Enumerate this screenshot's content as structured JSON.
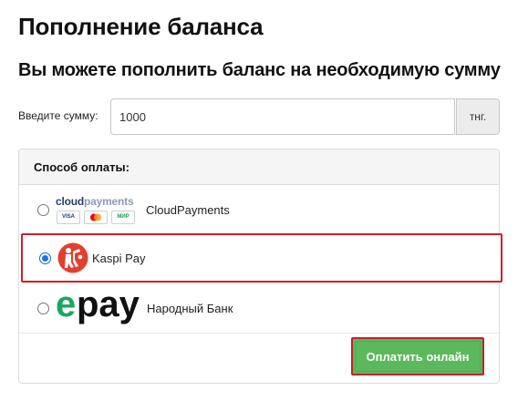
{
  "page": {
    "title": "Пополнение баланса",
    "subtitle": "Вы можете пополнить баланс на необходимую сумму"
  },
  "amount": {
    "label": "Введите сумму:",
    "value": "1000",
    "currency": "тнг."
  },
  "payment": {
    "header": "Способ оплаты:",
    "options": [
      {
        "label": "CloudPayments",
        "selected": false,
        "logo": {
          "word_part1": "cloud",
          "word_part2": "payments",
          "cards": [
            "VISA",
            "MC",
            "МИР"
          ]
        }
      },
      {
        "label": "Kaspi Pay",
        "selected": true,
        "logo": {
          "icon": "kaspi-logo-icon",
          "color": "#e2402f"
        }
      },
      {
        "label": "Народный Банк",
        "selected": false,
        "logo": {
          "word": "epay",
          "e_color": "#1da462"
        }
      }
    ],
    "selected_highlight_color": "#d11f2a"
  },
  "submit": {
    "label": "Оплатить онлайн",
    "color": "#5cb85c"
  }
}
